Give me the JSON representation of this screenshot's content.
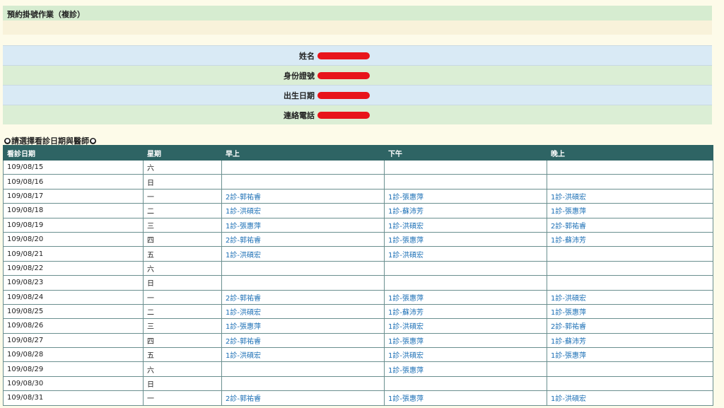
{
  "page": {
    "title": "預約掛號作業（複診）"
  },
  "form": {
    "rows": [
      {
        "label": "姓名"
      },
      {
        "label": "身份證號"
      },
      {
        "label": "出生日期"
      },
      {
        "label": "連絡電話"
      }
    ]
  },
  "hint": "請選擇看診日期與醫師",
  "table": {
    "headers": [
      "看診日期",
      "星期",
      "早上",
      "下午",
      "晚上"
    ],
    "rows": [
      {
        "date": "109/08/15",
        "weekday": "六",
        "morning": "",
        "afternoon": "",
        "evening": ""
      },
      {
        "date": "109/08/16",
        "weekday": "日",
        "morning": "",
        "afternoon": "",
        "evening": ""
      },
      {
        "date": "109/08/17",
        "weekday": "一",
        "morning": "2診-郭祐睿",
        "afternoon": "1診-張惠萍",
        "evening": "1診-洪碩宏"
      },
      {
        "date": "109/08/18",
        "weekday": "二",
        "morning": "1診-洪碩宏",
        "afternoon": "1診-蘇沛芳",
        "evening": "1診-張惠萍"
      },
      {
        "date": "109/08/19",
        "weekday": "三",
        "morning": "1診-張惠萍",
        "afternoon": "1診-洪碩宏",
        "evening": "2診-郭祐睿"
      },
      {
        "date": "109/08/20",
        "weekday": "四",
        "morning": "2診-郭祐睿",
        "afternoon": "1診-張惠萍",
        "evening": "1診-蘇沛芳"
      },
      {
        "date": "109/08/21",
        "weekday": "五",
        "morning": "1診-洪碩宏",
        "afternoon": "1診-洪碩宏",
        "evening": ""
      },
      {
        "date": "109/08/22",
        "weekday": "六",
        "morning": "",
        "afternoon": "",
        "evening": ""
      },
      {
        "date": "109/08/23",
        "weekday": "日",
        "morning": "",
        "afternoon": "",
        "evening": ""
      },
      {
        "date": "109/08/24",
        "weekday": "一",
        "morning": "2診-郭祐睿",
        "afternoon": "1診-張惠萍",
        "evening": "1診-洪碩宏"
      },
      {
        "date": "109/08/25",
        "weekday": "二",
        "morning": "1診-洪碩宏",
        "afternoon": "1診-蘇沛芳",
        "evening": "1診-張惠萍"
      },
      {
        "date": "109/08/26",
        "weekday": "三",
        "morning": "1診-張惠萍",
        "afternoon": "1診-洪碩宏",
        "evening": "2診-郭祐睿"
      },
      {
        "date": "109/08/27",
        "weekday": "四",
        "morning": "2診-郭祐睿",
        "afternoon": "1診-張惠萍",
        "evening": "1診-蘇沛芳"
      },
      {
        "date": "109/08/28",
        "weekday": "五",
        "morning": "1診-洪碩宏",
        "afternoon": "1診-洪碩宏",
        "evening": "1診-張惠萍"
      },
      {
        "date": "109/08/29",
        "weekday": "六",
        "morning": "",
        "afternoon": "1診-張惠萍",
        "evening": ""
      },
      {
        "date": "109/08/30",
        "weekday": "日",
        "morning": "",
        "afternoon": "",
        "evening": ""
      },
      {
        "date": "109/08/31",
        "weekday": "一",
        "morning": "2診-郭祐睿",
        "afternoon": "1診-張惠萍",
        "evening": "1診-洪碩宏"
      }
    ]
  },
  "colors": {
    "header_bg": "#2e6464",
    "link": "#1b6fb5",
    "redaction": "#e8141b"
  }
}
